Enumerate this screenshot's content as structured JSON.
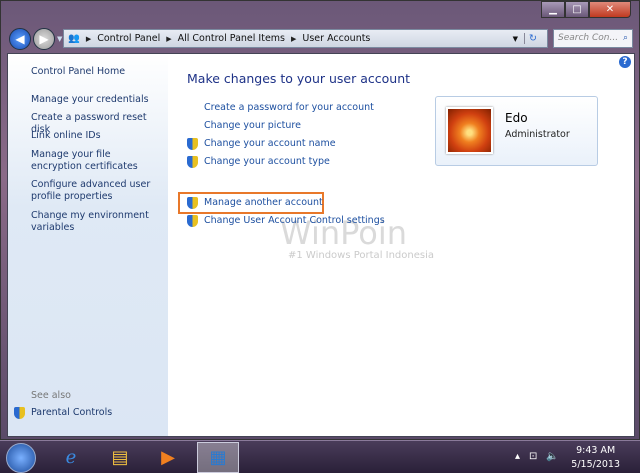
{
  "address": {
    "crumbs": [
      "Control Panel",
      "All Control Panel Items",
      "User Accounts"
    ],
    "search_placeholder": "Search Con..."
  },
  "sidebar": {
    "items": [
      "Control Panel Home",
      "Manage your credentials",
      "Create a password reset disk",
      "Link online IDs",
      "Manage your file encryption certificates",
      "Configure advanced user profile properties",
      "Change my environment variables"
    ],
    "see_also": "See also",
    "parental": "Parental Controls"
  },
  "main": {
    "title": "Make changes to your user account",
    "links": [
      "Create a password for your account",
      "Change your picture",
      "Change your account name",
      "Change your account type",
      "Manage another account",
      "Change User Account Control settings"
    ]
  },
  "user": {
    "name": "Edo",
    "role": "Administrator"
  },
  "watermark": {
    "logo": "WinPoin",
    "tagline": "#1 Windows Portal Indonesia"
  },
  "taskbar": {
    "time": "9:43 AM",
    "date": "5/15/2013"
  },
  "accent": "#e8782a"
}
